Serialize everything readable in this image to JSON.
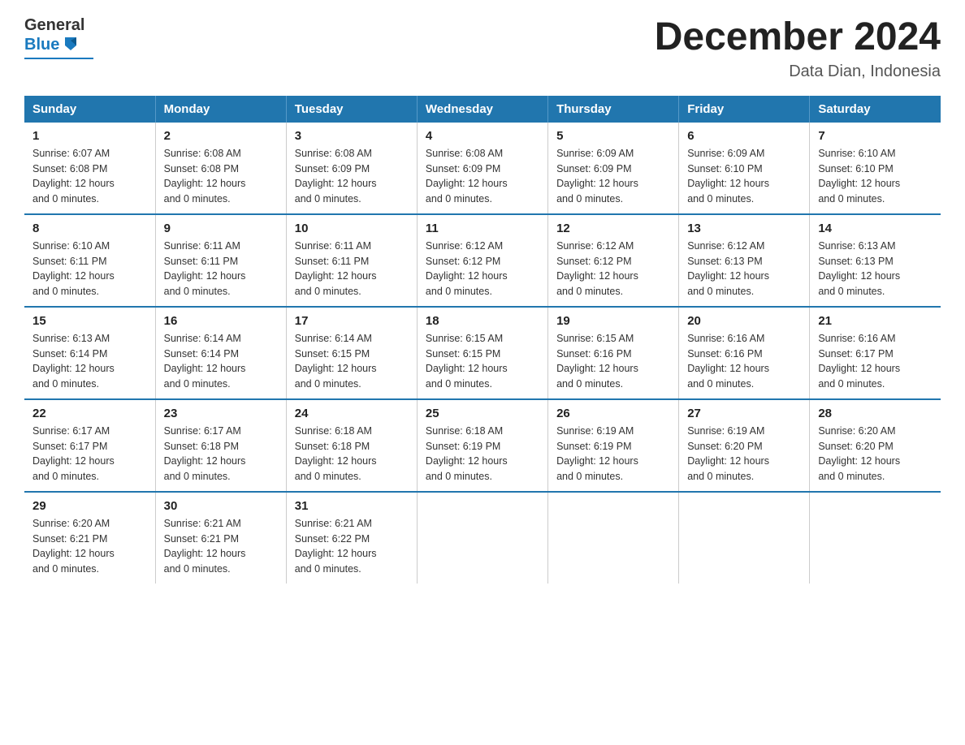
{
  "header": {
    "logo_general": "General",
    "logo_blue": "Blue",
    "title": "December 2024",
    "subtitle": "Data Dian, Indonesia"
  },
  "days_of_week": [
    "Sunday",
    "Monday",
    "Tuesday",
    "Wednesday",
    "Thursday",
    "Friday",
    "Saturday"
  ],
  "weeks": [
    [
      {
        "day": "1",
        "sunrise": "6:07 AM",
        "sunset": "6:08 PM",
        "daylight": "12 hours and 0 minutes."
      },
      {
        "day": "2",
        "sunrise": "6:08 AM",
        "sunset": "6:08 PM",
        "daylight": "12 hours and 0 minutes."
      },
      {
        "day": "3",
        "sunrise": "6:08 AM",
        "sunset": "6:09 PM",
        "daylight": "12 hours and 0 minutes."
      },
      {
        "day": "4",
        "sunrise": "6:08 AM",
        "sunset": "6:09 PM",
        "daylight": "12 hours and 0 minutes."
      },
      {
        "day": "5",
        "sunrise": "6:09 AM",
        "sunset": "6:09 PM",
        "daylight": "12 hours and 0 minutes."
      },
      {
        "day": "6",
        "sunrise": "6:09 AM",
        "sunset": "6:10 PM",
        "daylight": "12 hours and 0 minutes."
      },
      {
        "day": "7",
        "sunrise": "6:10 AM",
        "sunset": "6:10 PM",
        "daylight": "12 hours and 0 minutes."
      }
    ],
    [
      {
        "day": "8",
        "sunrise": "6:10 AM",
        "sunset": "6:11 PM",
        "daylight": "12 hours and 0 minutes."
      },
      {
        "day": "9",
        "sunrise": "6:11 AM",
        "sunset": "6:11 PM",
        "daylight": "12 hours and 0 minutes."
      },
      {
        "day": "10",
        "sunrise": "6:11 AM",
        "sunset": "6:11 PM",
        "daylight": "12 hours and 0 minutes."
      },
      {
        "day": "11",
        "sunrise": "6:12 AM",
        "sunset": "6:12 PM",
        "daylight": "12 hours and 0 minutes."
      },
      {
        "day": "12",
        "sunrise": "6:12 AM",
        "sunset": "6:12 PM",
        "daylight": "12 hours and 0 minutes."
      },
      {
        "day": "13",
        "sunrise": "6:12 AM",
        "sunset": "6:13 PM",
        "daylight": "12 hours and 0 minutes."
      },
      {
        "day": "14",
        "sunrise": "6:13 AM",
        "sunset": "6:13 PM",
        "daylight": "12 hours and 0 minutes."
      }
    ],
    [
      {
        "day": "15",
        "sunrise": "6:13 AM",
        "sunset": "6:14 PM",
        "daylight": "12 hours and 0 minutes."
      },
      {
        "day": "16",
        "sunrise": "6:14 AM",
        "sunset": "6:14 PM",
        "daylight": "12 hours and 0 minutes."
      },
      {
        "day": "17",
        "sunrise": "6:14 AM",
        "sunset": "6:15 PM",
        "daylight": "12 hours and 0 minutes."
      },
      {
        "day": "18",
        "sunrise": "6:15 AM",
        "sunset": "6:15 PM",
        "daylight": "12 hours and 0 minutes."
      },
      {
        "day": "19",
        "sunrise": "6:15 AM",
        "sunset": "6:16 PM",
        "daylight": "12 hours and 0 minutes."
      },
      {
        "day": "20",
        "sunrise": "6:16 AM",
        "sunset": "6:16 PM",
        "daylight": "12 hours and 0 minutes."
      },
      {
        "day": "21",
        "sunrise": "6:16 AM",
        "sunset": "6:17 PM",
        "daylight": "12 hours and 0 minutes."
      }
    ],
    [
      {
        "day": "22",
        "sunrise": "6:17 AM",
        "sunset": "6:17 PM",
        "daylight": "12 hours and 0 minutes."
      },
      {
        "day": "23",
        "sunrise": "6:17 AM",
        "sunset": "6:18 PM",
        "daylight": "12 hours and 0 minutes."
      },
      {
        "day": "24",
        "sunrise": "6:18 AM",
        "sunset": "6:18 PM",
        "daylight": "12 hours and 0 minutes."
      },
      {
        "day": "25",
        "sunrise": "6:18 AM",
        "sunset": "6:19 PM",
        "daylight": "12 hours and 0 minutes."
      },
      {
        "day": "26",
        "sunrise": "6:19 AM",
        "sunset": "6:19 PM",
        "daylight": "12 hours and 0 minutes."
      },
      {
        "day": "27",
        "sunrise": "6:19 AM",
        "sunset": "6:20 PM",
        "daylight": "12 hours and 0 minutes."
      },
      {
        "day": "28",
        "sunrise": "6:20 AM",
        "sunset": "6:20 PM",
        "daylight": "12 hours and 0 minutes."
      }
    ],
    [
      {
        "day": "29",
        "sunrise": "6:20 AM",
        "sunset": "6:21 PM",
        "daylight": "12 hours and 0 minutes."
      },
      {
        "day": "30",
        "sunrise": "6:21 AM",
        "sunset": "6:21 PM",
        "daylight": "12 hours and 0 minutes."
      },
      {
        "day": "31",
        "sunrise": "6:21 AM",
        "sunset": "6:22 PM",
        "daylight": "12 hours and 0 minutes."
      },
      null,
      null,
      null,
      null
    ]
  ],
  "labels": {
    "sunrise": "Sunrise:",
    "sunset": "Sunset:",
    "daylight": "Daylight:"
  }
}
